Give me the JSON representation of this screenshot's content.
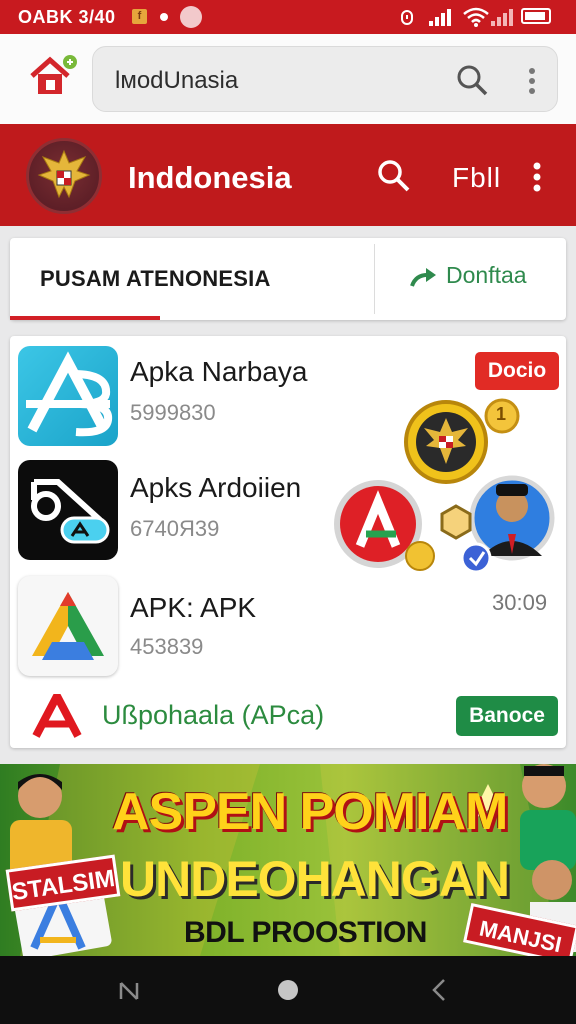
{
  "status": {
    "time": "OABK 3/40",
    "notif_badge": "f"
  },
  "search": {
    "query": "lмodUnasia"
  },
  "appbar": {
    "title": "Inddonesia",
    "action_text": "Fbll"
  },
  "tabs": {
    "left": "PUSAM ATENONESIA",
    "right": "Donftaa"
  },
  "apps": [
    {
      "name": "Apka Narbaya",
      "number": "5999830",
      "badge": "Docio"
    },
    {
      "name": "Apks Ardoiien",
      "number": "6740Я39"
    },
    {
      "name": "APK: APK",
      "number": "453839",
      "time": "30:09"
    }
  ],
  "footer_row": {
    "text": "Ußpohaala (APca)",
    "button": "Banoce"
  },
  "coin": {
    "digit": "1"
  },
  "banner": {
    "line1": "ASPEN POMIAM",
    "line2": "UNDEOHANGAN",
    "line3": "BDL PROOSTION",
    "tag_left": "STALSIM",
    "tag_right": "MANJSI"
  },
  "colors": {
    "brand_red": "#bf1a1c",
    "accent_green": "#2f8a4d",
    "badge_red": "#e12b25",
    "button_green": "#1f8c46"
  }
}
